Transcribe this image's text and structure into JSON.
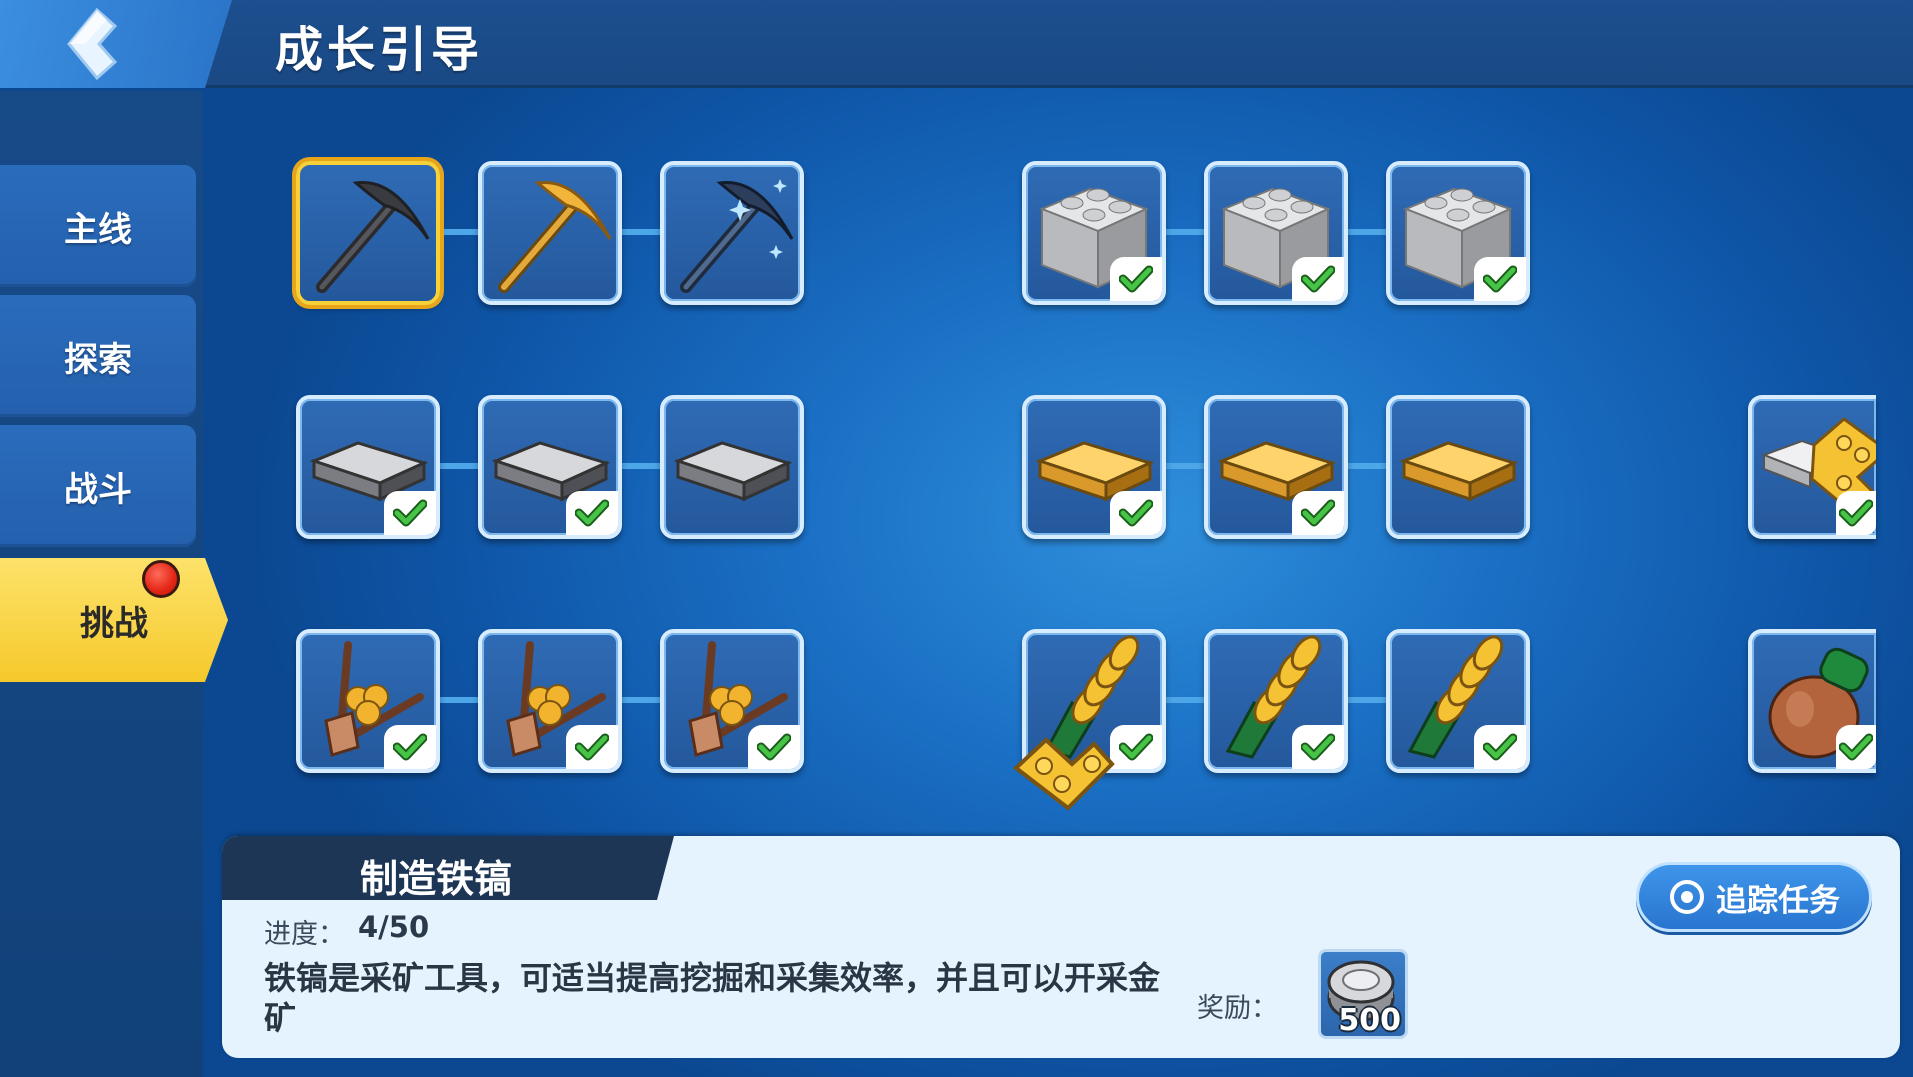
{
  "header": {
    "title": "成长引导"
  },
  "sidebar": {
    "tabs": [
      {
        "label": "主线",
        "active": false
      },
      {
        "label": "探索",
        "active": false
      },
      {
        "label": "战斗",
        "active": false
      },
      {
        "label": "挑战",
        "active": true,
        "badge": true
      }
    ]
  },
  "grid": {
    "rows": [
      {
        "groups": [
          {
            "items": [
              {
                "icon": "iron-pickaxe-icon",
                "completed": false,
                "selected": true
              },
              {
                "icon": "gold-pickaxe-icon",
                "completed": false
              },
              {
                "icon": "crystal-pickaxe-icon",
                "completed": false
              }
            ]
          },
          {
            "items": [
              {
                "icon": "grey-brick-icon",
                "completed": true
              },
              {
                "icon": "grey-brick-icon",
                "completed": true
              },
              {
                "icon": "grey-brick-icon",
                "completed": true
              }
            ]
          }
        ]
      },
      {
        "groups": [
          {
            "items": [
              {
                "icon": "iron-ingot-icon",
                "completed": true
              },
              {
                "icon": "iron-ingot-icon",
                "completed": true
              },
              {
                "icon": "iron-ingot-icon",
                "completed": false
              }
            ]
          },
          {
            "items": [
              {
                "icon": "gold-ingot-icon",
                "completed": true
              },
              {
                "icon": "gold-ingot-icon",
                "completed": true
              },
              {
                "icon": "gold-ingot-icon",
                "completed": false
              }
            ]
          },
          {
            "items": [
              {
                "icon": "ingot-and-gold-brick-icon",
                "completed": true
              }
            ]
          }
        ]
      },
      {
        "groups": [
          {
            "items": [
              {
                "icon": "tree-sapling-icon",
                "completed": true
              },
              {
                "icon": "tree-sapling-icon",
                "completed": true
              },
              {
                "icon": "tree-sapling-icon",
                "completed": true
              }
            ]
          },
          {
            "items": [
              {
                "icon": "corn-stalk-icon",
                "completed": true,
                "reward_badge": true
              },
              {
                "icon": "corn-stalk-icon",
                "completed": true
              },
              {
                "icon": "corn-stalk-icon",
                "completed": true
              }
            ]
          },
          {
            "items": [
              {
                "icon": "potion-jar-icon",
                "completed": true
              }
            ]
          }
        ]
      }
    ]
  },
  "task": {
    "title": "制造铁镐",
    "progress_label": "进度：",
    "progress_value": "4/50",
    "description": "铁镐是采矿工具，可适当提高挖掘和采集效率，并且可以开采金矿",
    "reward_label": "奖励：",
    "reward_amount": "500",
    "reward_icon": "silver-stud-coin-icon",
    "track_button_label": "追踪任务",
    "track_icon": "eye-icon"
  },
  "colors": {
    "accent_yellow": "#f5c92b",
    "panel_bg": "#e4f3fd",
    "check_green": "#3cb83c"
  }
}
